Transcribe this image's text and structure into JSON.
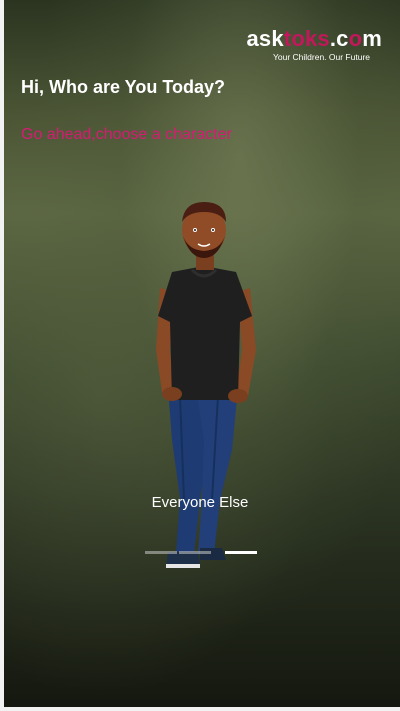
{
  "brand": {
    "logo_ask": "ask",
    "logo_toks": "toks",
    "logo_dot": ".c",
    "logo_o": "o",
    "logo_m": "m",
    "tagline": "Your Children. Our Future",
    "accent_color": "#c2185b"
  },
  "header": {
    "title": "Hi, Who are You Today?",
    "subtitle": "Go ahead,choose a character"
  },
  "carousel": {
    "character_label": "Everyone Else",
    "character_icon": "man-avatar-illustration",
    "page_count": 3,
    "active_index": 2
  }
}
